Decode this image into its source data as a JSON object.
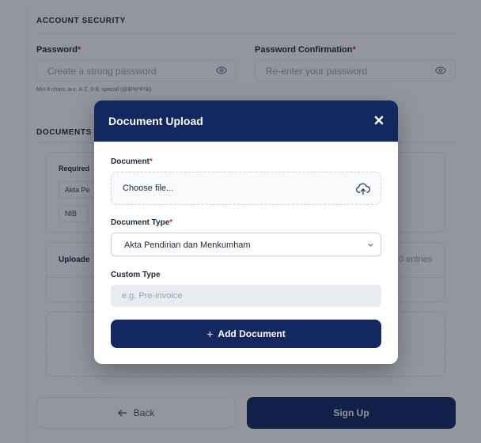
{
  "account_security": {
    "title": "ACCOUNT SECURITY",
    "password_label": "Password",
    "password_placeholder": "Create a strong password",
    "password_hint": "Min 8 chars: a-z, A-Z, 0-9, special (@$!%*#?&)",
    "confirm_label": "Password Confirmation",
    "confirm_placeholder": "Re-enter your password",
    "required_marker": "*"
  },
  "documents": {
    "title": "DOCUMENTS",
    "required_label": "Required",
    "required_chips": [
      "Akta Pe",
      "NIB"
    ],
    "uploaded_label": "Uploade",
    "entries_text": "0 entries"
  },
  "footer": {
    "back_label": "Back",
    "back_icon": "arrow-left-icon",
    "signup_label": "Sign Up"
  },
  "modal": {
    "title": "Document Upload",
    "close_icon": "close-icon",
    "document_label": "Document",
    "file_placeholder": "Choose file...",
    "upload_icon": "cloud-upload-icon",
    "type_label": "Document Type",
    "type_value": "Akta Pendirian dan Menkumham",
    "custom_label": "Custom Type",
    "custom_placeholder": "e.g. Pre-invoice",
    "add_label": "Add Document",
    "add_symbol": "+",
    "required_marker": "*"
  },
  "colors": {
    "primary": "#13285e",
    "required": "#e11d48",
    "overlay": "rgba(15,23,42,0.45)"
  }
}
